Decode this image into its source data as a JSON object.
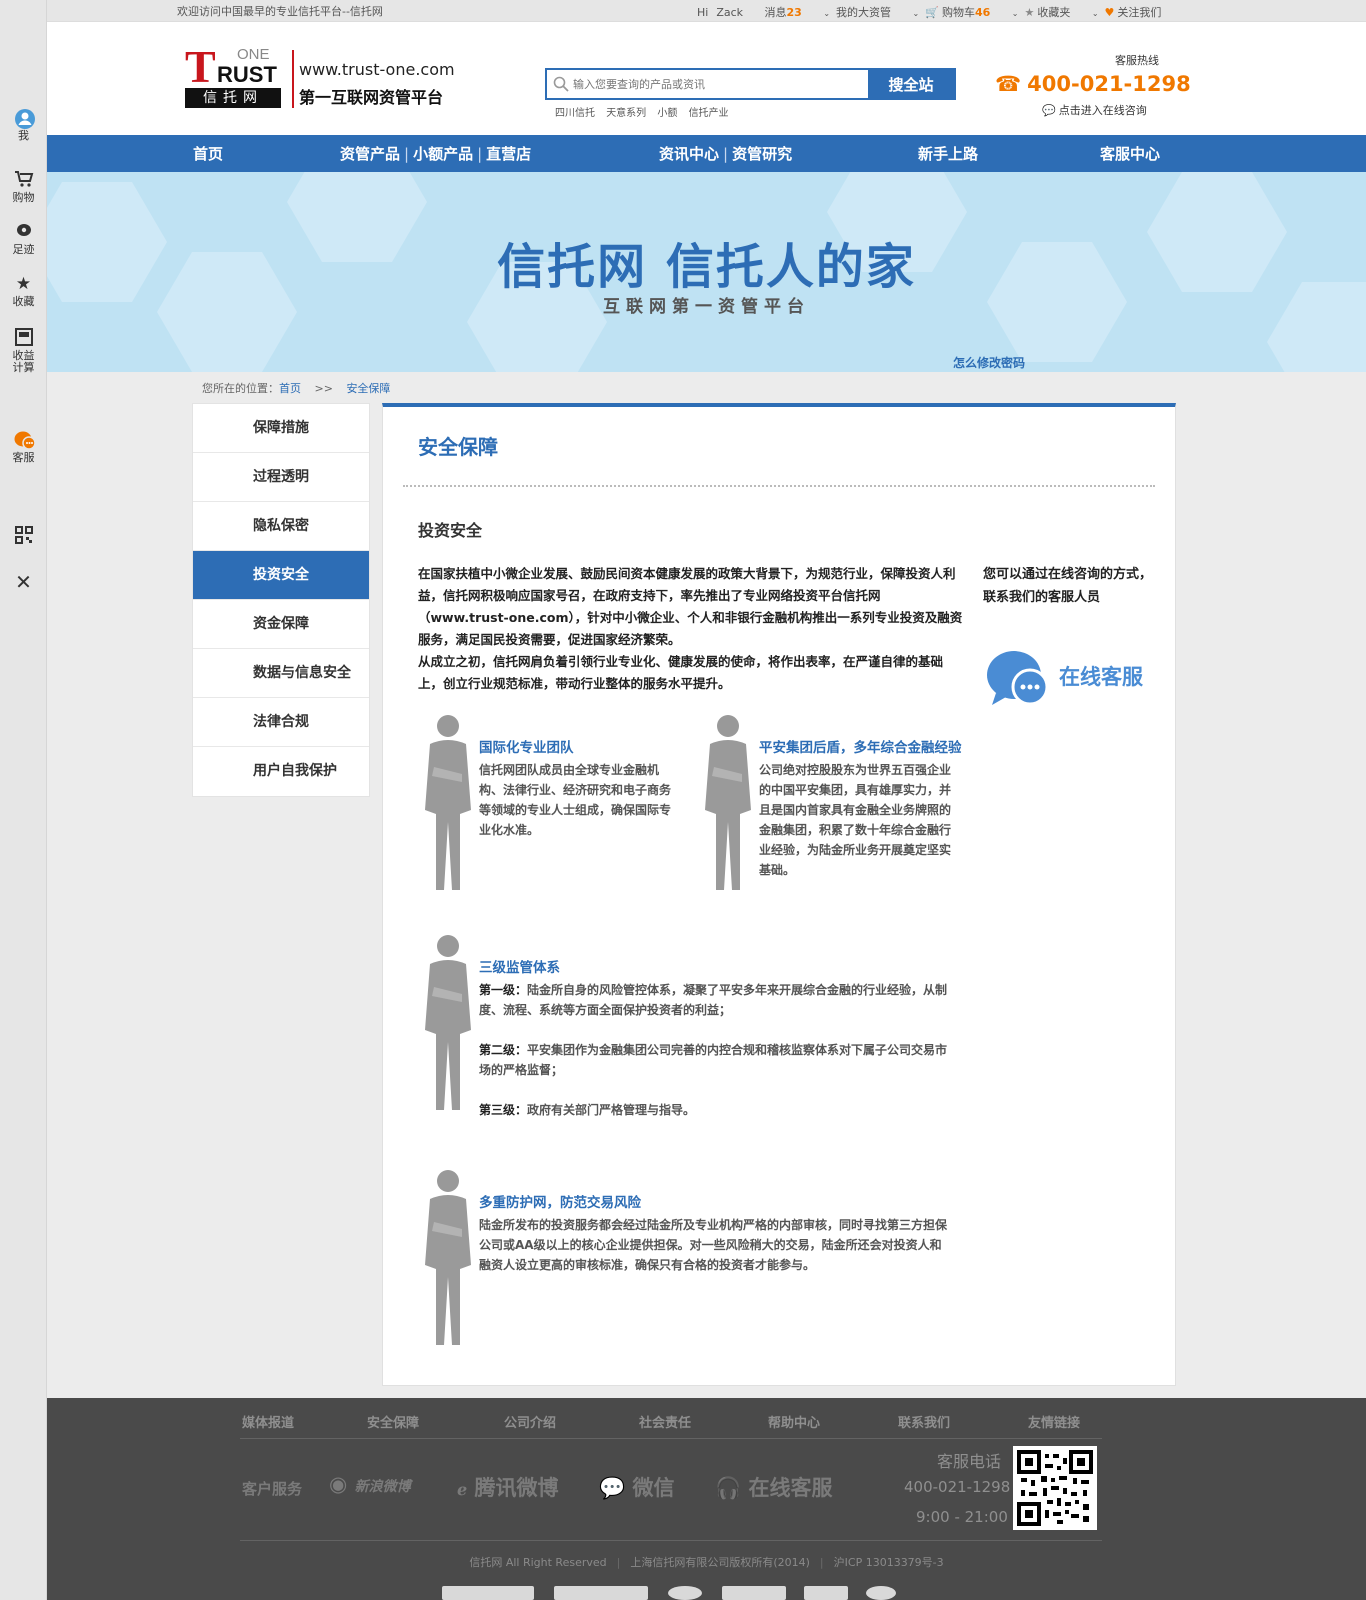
{
  "topbar": {
    "welcome": "欢迎访问中国最早的专业信托平台--信托网",
    "hi": "Hi",
    "username": "Zack",
    "messages_label": "消息",
    "messages_count": "23",
    "my_assets": "我的大资管",
    "cart_label": "购物车",
    "cart_count": "46",
    "favorites": "收藏夹",
    "follow": "关注我们"
  },
  "leftbar": {
    "me": "我",
    "cart": "购物",
    "history": "足迹",
    "favorites": "收藏",
    "calc": "收益计算",
    "service": "客服"
  },
  "header": {
    "logo_one": "ONE",
    "logo_rust": "RUST",
    "logo_cn": "信托网",
    "url": "www.trust-one.com",
    "slogan": "第一互联网资管平台",
    "search_placeholder": "输入您要查询的产品或资讯",
    "search_button": "搜全站",
    "hotwords": [
      "四川信托",
      "天意系列",
      "小额",
      "信托产业"
    ],
    "hotline_label": "客服热线",
    "hotline": "400-021-1298",
    "consult": "点击进入在线咨询"
  },
  "nav": {
    "home": "首页",
    "products": "资管产品",
    "small": "小额产品",
    "store": "直营店",
    "news": "资讯中心",
    "research": "资管研究",
    "newbie": "新手上路",
    "service": "客服中心"
  },
  "banner": {
    "title": "信托网 信托人的家",
    "subtitle": "互联网第一资管平台",
    "link": "怎么修改密码"
  },
  "breadcrumb": {
    "prefix": "您所在的位置：",
    "home": "首页",
    "sep": ">>",
    "current": "安全保障"
  },
  "sidemenu": [
    "保障措施",
    "过程透明",
    "隐私保密",
    "投资安全",
    "资金保障",
    "数据与信息安全",
    "法律合规",
    "用户自我保护"
  ],
  "content": {
    "title": "安全保障",
    "subtitle": "投资安全",
    "intro_p1": "在国家扶植中小微企业发展、鼓励民间资本健康发展的政策大背景下，为规范行业，保障投资人利益，信托网积极响应国家号召，在政府支持下，率先推出了专业网络投资平台信托网（www.trust-one.com），针对中小微企业、个人和非银行金融机构推出一系列专业投资及融资服务，满足国民投资需要，促进国家经济繁荣。",
    "intro_p2": "从成立之初，信托网肩负着引领行业专业化、健康发展的使命，将作出表率，在严谨自律的基础上，创立行业规范标准，带动行业整体的服务水平提升。",
    "side_text": "您可以通过在线咨询的方式，联系我们的客服人员",
    "online_service": "在线客服",
    "f1_title": "国际化专业团队",
    "f1_body": "信托网团队成员由全球专业金融机构、法律行业、经济研究和电子商务等领域的专业人士组成，确保国际专业化水准。",
    "f2_title": "平安集团后盾，多年综合金融经验",
    "f2_body": "公司绝对控股股东为世界五百强企业的中国平安集团，具有雄厚实力，并且是国内首家具有金融全业务牌照的金融集团，积累了数十年综合金融行业经验，为陆金所业务开展奠定坚实基础。",
    "f3_title": "三级监管体系",
    "f3_l1_label": "第一级：",
    "f3_l1": "陆金所自身的风险管控体系，凝聚了平安多年来开展综合金融的行业经验，从制度、流程、系统等方面全面保护投资者的利益；",
    "f3_l2_label": "第二级：",
    "f3_l2": "平安集团作为金融集团公司完善的内控合规和稽核监察体系对下属子公司交易市场的严格监督；",
    "f3_l3_label": "第三级：",
    "f3_l3": "政府有关部门严格管理与指导。",
    "f4_title": "多重防护网，防范交易风险",
    "f4_body": "陆金所发布的投资服务都会经过陆金所及专业机构严格的内部审核，同时寻找第三方担保公司或AA级以上的核心企业提供担保。对一些风险稍大的交易，陆金所还会对投资人和融资人设立更高的审核标准，确保只有合格的投资者才能参与。"
  },
  "footer": {
    "links": [
      "媒体报道",
      "安全保障",
      "公司介绍",
      "社会责任",
      "帮助中心",
      "联系我们",
      "友情链接"
    ],
    "customer_service": "客户服务",
    "weibo_sina": "新浪微博",
    "weibo_tencent": "腾讯微博",
    "wechat": "微信",
    "online": "在线客服",
    "phone_label": "客服电话",
    "phone": "400-021-1298",
    "hours": "9:00 - 21:00",
    "copy1": "信托网 All Right Reserved",
    "copy2": "上海信托网有限公司版权所有(2014)",
    "copy3": "沪ICP 13013379号-3"
  },
  "colors": {
    "brand_blue": "#2d6db5",
    "accent_orange": "#f07800",
    "logo_red": "#c8161d",
    "footer_bg": "#4a4a4a"
  }
}
